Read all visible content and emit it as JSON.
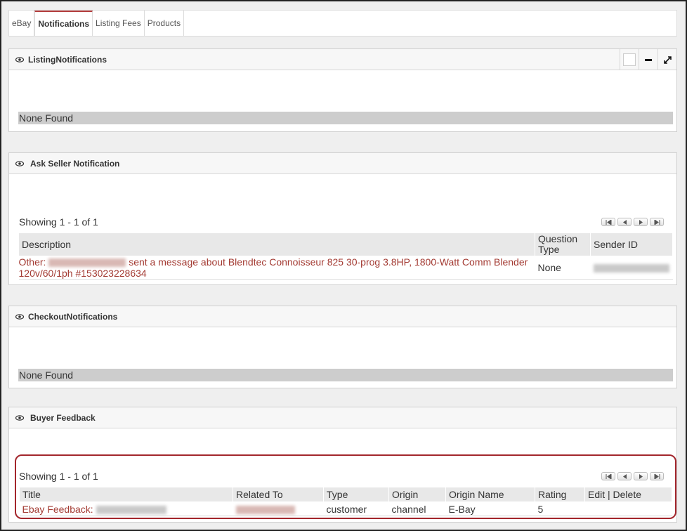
{
  "tabs": [
    "eBay",
    "Notifications",
    "Listing Fees",
    "Products"
  ],
  "listing": {
    "title": "ListingNotifications",
    "empty": "None Found"
  },
  "ask": {
    "title": "Ask Seller Notification",
    "showing": "Showing 1 - 1 of 1",
    "columns": [
      "Description",
      "Question Type",
      "Sender ID"
    ],
    "row": {
      "prefix": "Other:",
      "message_line1": "sent a message about Blendtec Connoisseur 825 30-prog 3.8HP, 1800-Watt Comm Blender",
      "message_line2": "120v/60/1ph #153023228634",
      "question_type": "None"
    }
  },
  "checkout": {
    "title": "CheckoutNotifications",
    "empty": "None Found"
  },
  "feedback": {
    "title": "Buyer Feedback",
    "showing": "Showing 1 - 1 of 1",
    "columns": [
      "Title",
      "Related To",
      "Type",
      "Origin",
      "Origin Name",
      "Rating",
      "Edit | Delete"
    ],
    "row": {
      "title": "Ebay Feedback:",
      "type": "customer",
      "origin": "channel",
      "origin_name": "E-Bay",
      "rating": "5"
    }
  },
  "icons": [
    "eye-icon",
    "checkbox-icon",
    "minimize-icon",
    "expand-icon",
    "first-page-icon",
    "prev-page-icon",
    "next-page-icon",
    "last-page-icon"
  ]
}
